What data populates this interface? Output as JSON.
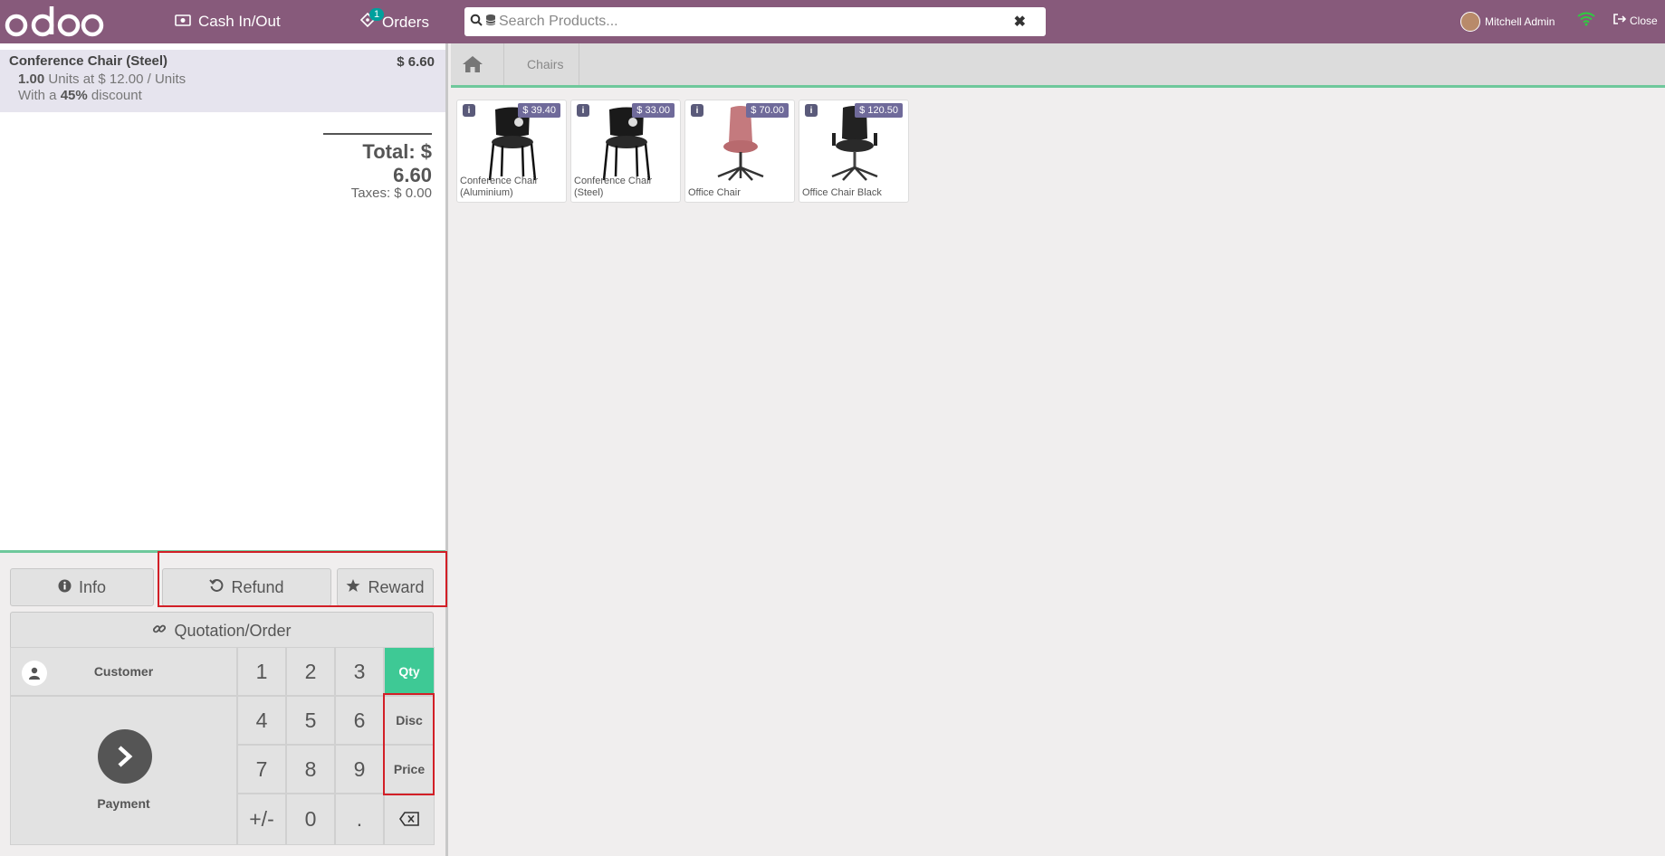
{
  "topbar": {
    "cash_label": "Cash In/Out",
    "orders_label": "Orders",
    "orders_count": "1",
    "search_placeholder": "Search Products...",
    "user_name": "Mitchell Admin",
    "close_label": "Close"
  },
  "order": {
    "line": {
      "name": "Conference Chair (Steel)",
      "price": "$ 6.60",
      "qty": "1.00",
      "unit_text": "Units at $ 12.00 / Units",
      "discount_prefix": "With a",
      "discount_pct": "45%",
      "discount_suffix": "discount"
    },
    "total": "Total: $ 6.60",
    "taxes": "Taxes: $ 0.00"
  },
  "control_buttons": {
    "info": "Info",
    "refund": "Refund",
    "reward": "Reward",
    "quotation": "Quotation/Order"
  },
  "numpad": {
    "customer": "Customer",
    "payment": "Payment",
    "keys": [
      "1",
      "2",
      "3",
      "4",
      "5",
      "6",
      "7",
      "8",
      "9",
      "+/-",
      "0",
      "."
    ],
    "qty": "Qty",
    "disc": "Disc",
    "price": "Price",
    "active_mode": "Qty"
  },
  "breadcrumb": {
    "category": "Chairs"
  },
  "products": [
    {
      "name": "Conference Chair (Aluminium)",
      "price": "$ 39.40",
      "icon": "black-chair-icon"
    },
    {
      "name": "Conference Chair (Steel)",
      "price": "$ 33.00",
      "icon": "black-chair-icon"
    },
    {
      "name": "Office Chair",
      "price": "$ 70.00",
      "icon": "pink-chair-icon"
    },
    {
      "name": "Office Chair Black",
      "price": "$ 120.50",
      "icon": "office-chair-icon"
    }
  ],
  "colors": {
    "topbar": "#875a7b",
    "accent": "#3ec995",
    "highlight": "#d21f27"
  }
}
